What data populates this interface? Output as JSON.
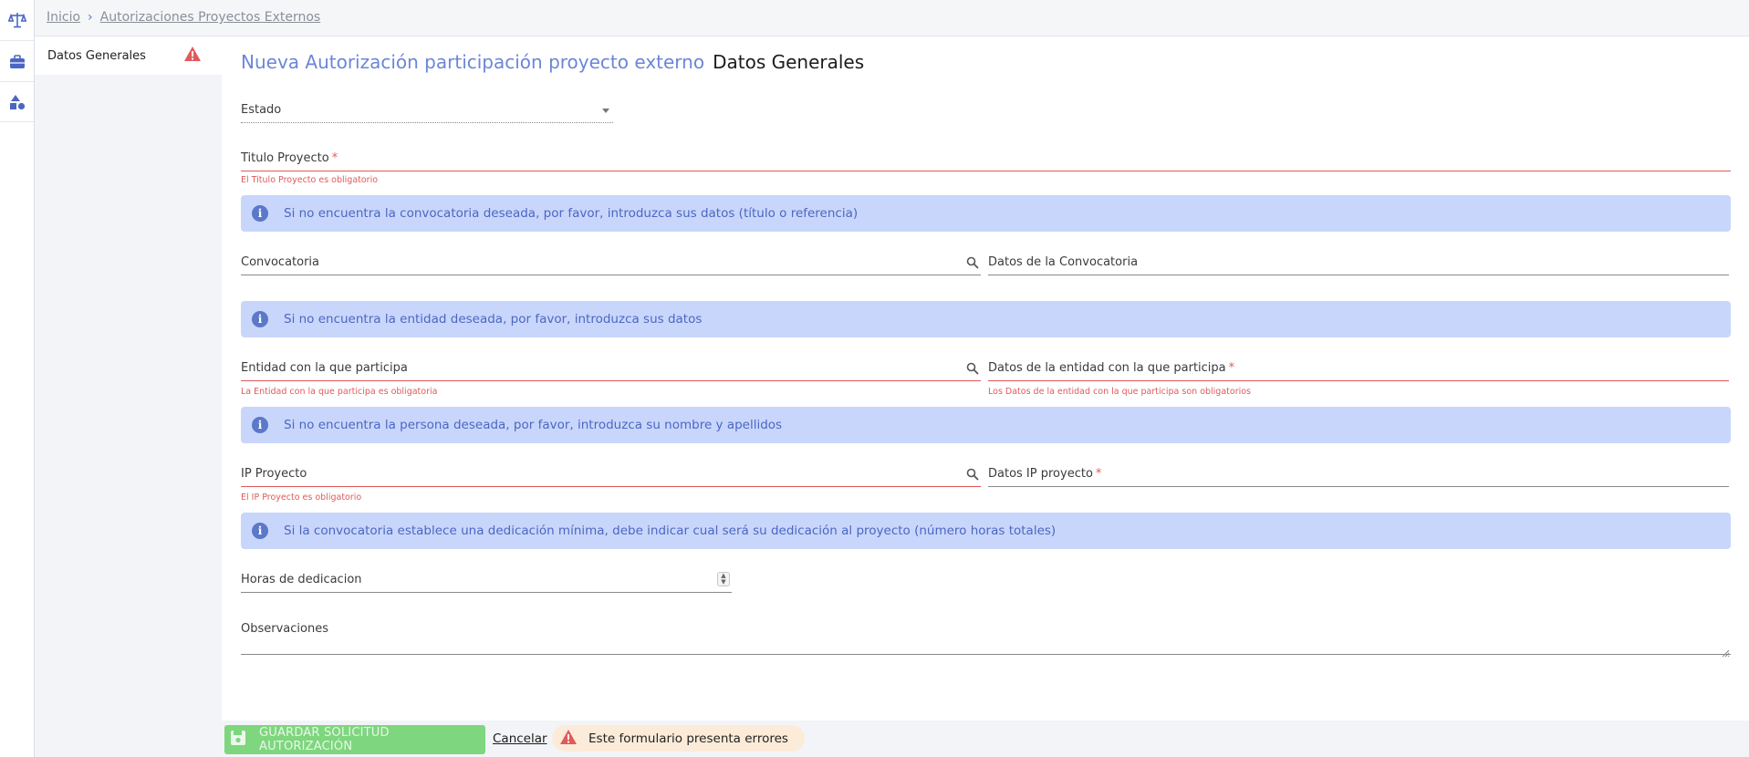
{
  "rail": {
    "icons": [
      "scale-icon",
      "briefcase-icon",
      "shapes-icon"
    ]
  },
  "breadcrumb": {
    "home": "Inicio",
    "current": "Autorizaciones Proyectos Externos"
  },
  "sidemenu": {
    "items": [
      {
        "label": "Datos Generales",
        "has_error": true
      }
    ]
  },
  "header": {
    "title": "Nueva Autorización participación proyecto externo",
    "section": "Datos Generales"
  },
  "form": {
    "estado": {
      "label": "Estado"
    },
    "titulo": {
      "label": "Titulo Proyecto",
      "required": "*",
      "error": "El Titulo Proyecto es obligatorio"
    },
    "info_convocatoria": "Si no encuentra la convocatoria deseada, por favor, introduzca sus datos (título o referencia)",
    "convocatoria": {
      "label": "Convocatoria"
    },
    "datos_convocatoria": {
      "label": "Datos de la Convocatoria"
    },
    "info_entidad": "Si no encuentra la entidad deseada, por favor, introduzca sus datos",
    "entidad": {
      "label": "Entidad con la que participa",
      "error": "La Entidad con la que participa es obligatoria"
    },
    "datos_entidad": {
      "label": "Datos de la entidad con la que participa",
      "required": "*",
      "error": "Los Datos de la entidad con la que participa son obligatorios"
    },
    "info_persona": "Si no encuentra la persona deseada, por favor, introduzca su nombre y apellidos",
    "ip": {
      "label": "IP Proyecto",
      "error": "El IP Proyecto es obligatorio"
    },
    "datos_ip": {
      "label": "Datos IP proyecto",
      "required": "*"
    },
    "info_dedicacion": "Si la convocatoria establece una dedicación mínima, debe indicar cual será su dedicación al proyecto (número horas totales)",
    "horas": {
      "label": "Horas de dedicacion"
    },
    "observaciones": {
      "label": "Observaciones"
    }
  },
  "footer": {
    "save_label": "GUARDAR SOLICITUD AUTORIZACIÓN",
    "cancel_label": "Cancelar",
    "errors_label": "Este formulario presenta errores"
  },
  "colors": {
    "accent": "#6b86d8",
    "error": "#e05a5a",
    "info_bg": "#c9d6fb",
    "save_bg": "#7ed67e"
  }
}
